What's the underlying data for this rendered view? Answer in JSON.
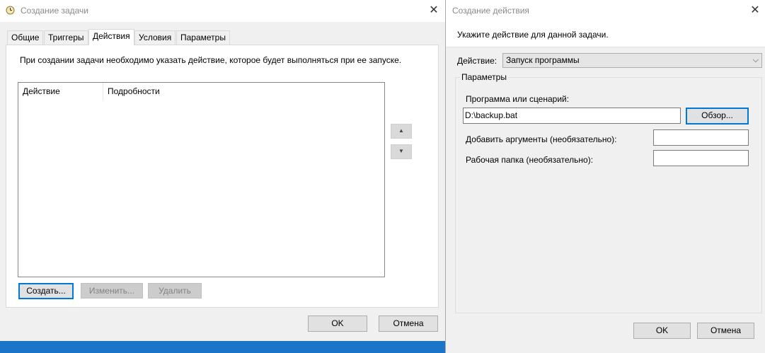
{
  "task_window": {
    "title": "Создание задачи",
    "tabs": [
      {
        "label": "Общие"
      },
      {
        "label": "Триггеры"
      },
      {
        "label": "Действия"
      },
      {
        "label": "Условия"
      },
      {
        "label": "Параметры"
      }
    ],
    "description": "При создании задачи необходимо указать действие, которое будет выполняться при ее запуске.",
    "columns": [
      "Действие",
      "Подробности"
    ],
    "create_label": "Создать...",
    "edit_label": "Изменить...",
    "delete_label": "Удалить",
    "ok_label": "OK",
    "cancel_label": "Отмена"
  },
  "action_window": {
    "title": "Создание действия",
    "instruction": "Укажите действие для данной задачи.",
    "action_label": "Действие:",
    "action_value": "Запуск программы",
    "group_title": "Параметры",
    "program_label": "Программа или сценарий:",
    "program_value": "D:\\backup.bat",
    "browse_label": "Обзор...",
    "args_label": "Добавить аргументы (необязательно):",
    "args_value": "",
    "workdir_label": "Рабочая папка (необязательно):",
    "workdir_value": "",
    "ok_label": "OK",
    "cancel_label": "Отмена"
  }
}
